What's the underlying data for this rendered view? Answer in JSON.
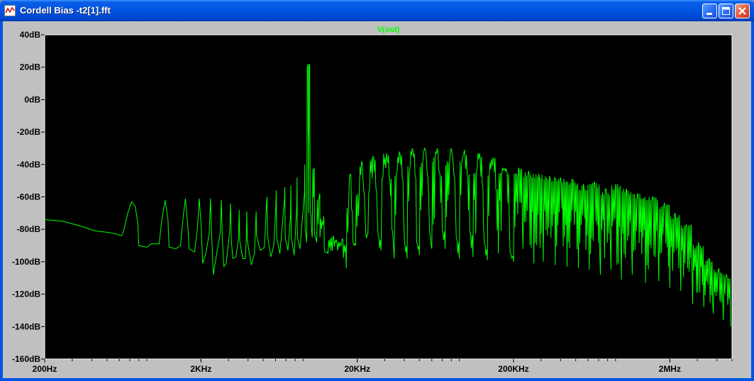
{
  "window": {
    "title": "Cordell Bias -t2[1].fft",
    "icons": {
      "app": "waveform-app-icon",
      "minimize": "minimize-icon",
      "maximize": "maximize-icon",
      "close": "close-icon"
    }
  },
  "colors": {
    "trace": "#00ff00",
    "plot_background": "#000000",
    "frame": "#c0c0c0",
    "axis": "#ffffff",
    "label_text": "#000000"
  },
  "chart_data": {
    "type": "line",
    "title": "",
    "xlabel": "",
    "ylabel": "",
    "x_scale": "log",
    "xlim": [
      200,
      5000000
    ],
    "ylim": [
      -160,
      40
    ],
    "grid": false,
    "legend": "top-center",
    "x_ticks": [
      {
        "value": 200,
        "label": "200Hz"
      },
      {
        "value": 2000,
        "label": "2KHz"
      },
      {
        "value": 20000,
        "label": "20KHz"
      },
      {
        "value": 200000,
        "label": "200KHz"
      },
      {
        "value": 2000000,
        "label": "2MHz"
      }
    ],
    "y_ticks": [
      {
        "value": 40,
        "label": "40dB"
      },
      {
        "value": 20,
        "label": "20dB"
      },
      {
        "value": 0,
        "label": "0dB"
      },
      {
        "value": -20,
        "label": "-20dB"
      },
      {
        "value": -40,
        "label": "-40dB"
      },
      {
        "value": -60,
        "label": "-60dB"
      },
      {
        "value": -80,
        "label": "-80dB"
      },
      {
        "value": -100,
        "label": "-100dB"
      },
      {
        "value": -120,
        "label": "-120dB"
      },
      {
        "value": -140,
        "label": "-140dB"
      },
      {
        "value": -160,
        "label": "-160dB"
      }
    ],
    "series": [
      {
        "name": "V(out)",
        "points": [
          [
            200,
            -74
          ],
          [
            260,
            -75
          ],
          [
            340,
            -78
          ],
          [
            420,
            -81
          ],
          [
            520,
            -82
          ],
          [
            580,
            -83
          ],
          [
            620,
            -84
          ],
          [
            640,
            -81
          ],
          [
            680,
            -70
          ],
          [
            720,
            -63
          ],
          [
            760,
            -66
          ],
          [
            790,
            -77
          ],
          [
            800,
            -90
          ],
          [
            900,
            -91
          ],
          [
            960,
            -89
          ],
          [
            1080,
            -89
          ],
          [
            1120,
            -75
          ],
          [
            1180,
            -62
          ],
          [
            1230,
            -74
          ],
          [
            1250,
            -91
          ],
          [
            1380,
            -92
          ],
          [
            1480,
            -90
          ],
          [
            1540,
            -72
          ],
          [
            1590,
            -61
          ],
          [
            1650,
            -79
          ],
          [
            1680,
            -92
          ],
          [
            1820,
            -94
          ],
          [
            1900,
            -79
          ],
          [
            1950,
            -61
          ],
          [
            2010,
            -79
          ],
          [
            2050,
            -101
          ],
          [
            2150,
            -95
          ],
          [
            2260,
            -82
          ],
          [
            2300,
            -61
          ],
          [
            2340,
            -83
          ],
          [
            2400,
            -108
          ],
          [
            2500,
            -97
          ],
          [
            2660,
            -82
          ],
          [
            2700,
            -62
          ],
          [
            2740,
            -86
          ],
          [
            2800,
            -103
          ],
          [
            2900,
            -101
          ],
          [
            3050,
            -82
          ],
          [
            3090,
            -64
          ],
          [
            3130,
            -87
          ],
          [
            3200,
            -98
          ],
          [
            3350,
            -97
          ],
          [
            3480,
            -85
          ],
          [
            3510,
            -68
          ],
          [
            3540,
            -87
          ],
          [
            3700,
            -98
          ],
          [
            3850,
            -98
          ],
          [
            3900,
            -85
          ],
          [
            3930,
            -69
          ],
          [
            3960,
            -87
          ],
          [
            4200,
            -102
          ],
          [
            4400,
            -95
          ],
          [
            4480,
            -76
          ],
          [
            4510,
            -69
          ],
          [
            4540,
            -84
          ],
          [
            4800,
            -93
          ],
          [
            5100,
            -91
          ],
          [
            5250,
            -64
          ],
          [
            5290,
            -60
          ],
          [
            5330,
            -84
          ],
          [
            5600,
            -97
          ],
          [
            5850,
            -90
          ],
          [
            6020,
            -67
          ],
          [
            6060,
            -56
          ],
          [
            6100,
            -85
          ],
          [
            6400,
            -95
          ],
          [
            6840,
            -62
          ],
          [
            6880,
            -54
          ],
          [
            6920,
            -85
          ],
          [
            7200,
            -93
          ],
          [
            7480,
            -72
          ],
          [
            7520,
            -53
          ],
          [
            7560,
            -85
          ],
          [
            7900,
            -96
          ],
          [
            8200,
            -66
          ],
          [
            8240,
            -48
          ],
          [
            8280,
            -85
          ],
          [
            8600,
            -92
          ],
          [
            9200,
            -57
          ],
          [
            9240,
            -40
          ],
          [
            9280,
            -80
          ],
          [
            9500,
            -88
          ],
          [
            9650,
            22
          ],
          [
            9700,
            -20
          ],
          [
            9750,
            -70
          ],
          [
            9900,
            22
          ],
          [
            9950,
            -25
          ],
          [
            10000,
            -68
          ],
          [
            10300,
            -85
          ],
          [
            10600,
            -42
          ],
          [
            10650,
            -82
          ],
          [
            11000,
            -88
          ],
          [
            11500,
            -58
          ],
          [
            11550,
            -85
          ],
          [
            12200,
            -72
          ],
          [
            12300,
            -92
          ],
          [
            13000,
            -95
          ],
          [
            14000,
            -84
          ],
          [
            15000,
            -93
          ],
          [
            16000,
            -86
          ],
          [
            17000,
            -104
          ],
          [
            17600,
            -66
          ],
          [
            18000,
            -46
          ],
          [
            18400,
            -68
          ],
          [
            18800,
            -88
          ],
          [
            19500,
            -90
          ],
          [
            20600,
            -58
          ],
          [
            21300,
            -38
          ],
          [
            22000,
            -56
          ],
          [
            22700,
            -83
          ],
          [
            23400,
            -83
          ],
          [
            24000,
            -55
          ],
          [
            25200,
            -35
          ],
          [
            26300,
            -54
          ],
          [
            27200,
            -84
          ],
          [
            28400,
            -93
          ],
          [
            29200,
            -48
          ],
          [
            30800,
            -33
          ],
          [
            32000,
            -48
          ],
          [
            33300,
            -80
          ],
          [
            34500,
            -98
          ],
          [
            36000,
            -44
          ],
          [
            37200,
            -32
          ],
          [
            38800,
            -48
          ],
          [
            40100,
            -87
          ],
          [
            41700,
            -98
          ],
          [
            43600,
            -41
          ],
          [
            45000,
            -30
          ],
          [
            46800,
            -46
          ],
          [
            48000,
            -88
          ],
          [
            50000,
            -96
          ],
          [
            52500,
            -38
          ],
          [
            54000,
            -30
          ],
          [
            56000,
            -45
          ],
          [
            58000,
            -81
          ],
          [
            60000,
            -92
          ],
          [
            63000,
            -35
          ],
          [
            65000,
            -30
          ],
          [
            67000,
            -45
          ],
          [
            70000,
            -80
          ],
          [
            73000,
            -92
          ],
          [
            78000,
            -38
          ],
          [
            80000,
            -30
          ],
          [
            83000,
            -46
          ],
          [
            86000,
            -85
          ],
          [
            90000,
            -98
          ],
          [
            94000,
            -37
          ],
          [
            97000,
            -31
          ],
          [
            101000,
            -46
          ],
          [
            105000,
            -82
          ],
          [
            110000,
            -97
          ],
          [
            117000,
            -42
          ],
          [
            121000,
            -33
          ],
          [
            126000,
            -51
          ],
          [
            130000,
            -89
          ],
          [
            136000,
            -99
          ],
          [
            140000,
            -45
          ],
          [
            148000,
            -36
          ],
          [
            154000,
            -55
          ],
          [
            160000,
            -95
          ],
          [
            170000,
            -42
          ],
          [
            180000,
            -43
          ],
          [
            190000,
            -94
          ],
          [
            200000,
            -100
          ],
          [
            215000,
            -42
          ],
          [
            230000,
            -92
          ],
          [
            250000,
            -44
          ],
          [
            270000,
            -101
          ],
          [
            290000,
            -46
          ],
          [
            310000,
            -100
          ],
          [
            340000,
            -47
          ],
          [
            370000,
            -102
          ],
          [
            400000,
            -48
          ],
          [
            440000,
            -103
          ],
          [
            480000,
            -49
          ],
          [
            520000,
            -104
          ],
          [
            560000,
            -52
          ],
          [
            610000,
            -105
          ],
          [
            660000,
            -51
          ],
          [
            720000,
            -108
          ],
          [
            780000,
            -55
          ],
          [
            840000,
            -105
          ],
          [
            900000,
            -52
          ],
          [
            980000,
            -111
          ],
          [
            1050000,
            -55
          ],
          [
            1150000,
            -108
          ],
          [
            1250000,
            -58
          ],
          [
            1400000,
            -113
          ],
          [
            1550000,
            -60
          ],
          [
            1700000,
            -112
          ],
          [
            1850000,
            -64
          ],
          [
            2000000,
            -116
          ],
          [
            2150000,
            -70
          ],
          [
            2350000,
            -118
          ],
          [
            2550000,
            -77
          ],
          [
            2800000,
            -126
          ],
          [
            3050000,
            -88
          ],
          [
            3300000,
            -128
          ],
          [
            3550000,
            -98
          ],
          [
            3800000,
            -132
          ],
          [
            4100000,
            -104
          ],
          [
            4400000,
            -136
          ],
          [
            4600000,
            -108
          ],
          [
            4900000,
            -140
          ]
        ]
      }
    ]
  }
}
